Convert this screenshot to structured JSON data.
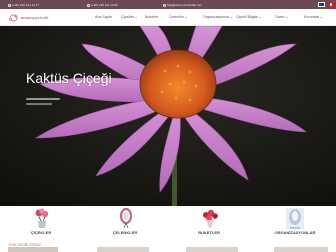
{
  "topbar": {
    "phone1": "(+90) 216 414 14 77",
    "phone2": "(+90) 216 111 40 80",
    "email": "bilgi@arzumcicekcilik.com"
  },
  "brand": {
    "name": "arzum",
    "suffix": "çiçekçilik"
  },
  "nav": {
    "items": [
      {
        "label": "Ana Sayfa",
        "dropdown": false
      },
      {
        "label": "Çiçekler",
        "dropdown": true
      },
      {
        "label": "Buketler",
        "dropdown": false
      },
      {
        "label": "Çelenkler",
        "dropdown": true
      },
      {
        "label": "Organizasyonlar",
        "dropdown": true
      },
      {
        "label": "Çiçekli Bilgiler",
        "dropdown": true
      },
      {
        "label": "Galeri",
        "dropdown": true
      },
      {
        "label": "Kurumsal",
        "dropdown": true
      }
    ]
  },
  "hero": {
    "title": "Kaktüs Çiçeği"
  },
  "categories": [
    {
      "label": "ÇİÇEKLER"
    },
    {
      "label": "ÇELENKLER"
    },
    {
      "label": "BUKETLER"
    },
    {
      "label": "ORGANİZASYONLAR"
    }
  ],
  "bottom": {
    "text": "YENİ ÜRÜNLERİMİZ"
  },
  "colors": {
    "topbar": "#6b4a58",
    "brand": "#b56a8a",
    "petal": "#c77ac9",
    "flower_center": "#d65a1e",
    "hero_background": "#161612"
  }
}
